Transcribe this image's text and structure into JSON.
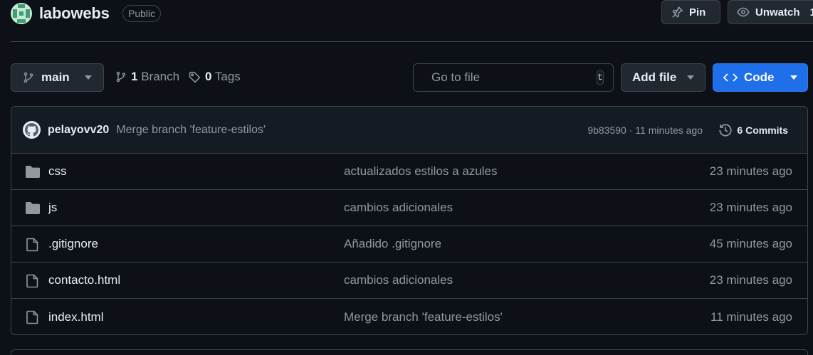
{
  "repo": {
    "name": "labowebs",
    "visibility": "Public",
    "pin_label": "Pin",
    "unwatch_label": "Unwatch",
    "watch_count": "1"
  },
  "toolbar": {
    "branch": "main",
    "branch_count": "1",
    "branch_label": "Branch",
    "tag_count": "0",
    "tag_label": "Tags",
    "search_placeholder": "Go to file",
    "search_shortcut": "t",
    "add_file_label": "Add file",
    "code_label": "Code"
  },
  "latest_commit": {
    "author": "pelayovv20",
    "message": "Merge branch 'feature-estilos'",
    "hash": "9b83590",
    "separator": "·",
    "time": "11 minutes ago",
    "commits_count": "6",
    "commits_label": "Commits"
  },
  "files": [
    {
      "name": "css",
      "type": "folder",
      "message": "actualizados estilos a azules",
      "time": "23 minutes ago"
    },
    {
      "name": "js",
      "type": "folder",
      "message": "cambios adicionales",
      "time": "23 minutes ago"
    },
    {
      "name": ".gitignore",
      "type": "file",
      "message": "Añadido .gitignore",
      "time": "45 minutes ago"
    },
    {
      "name": "contacto.html",
      "type": "file",
      "message": "cambios adicionales",
      "time": "23 minutes ago"
    },
    {
      "name": "index.html",
      "type": "file",
      "message": "Merge branch 'feature-estilos'",
      "time": "11 minutes ago"
    }
  ],
  "colors": {
    "background": "#0d1117",
    "border": "#3d444d",
    "primary_button": "#1f6feb",
    "muted_text": "#9198a1"
  },
  "icons": {
    "folder": "folder-icon",
    "file": "file-icon"
  }
}
